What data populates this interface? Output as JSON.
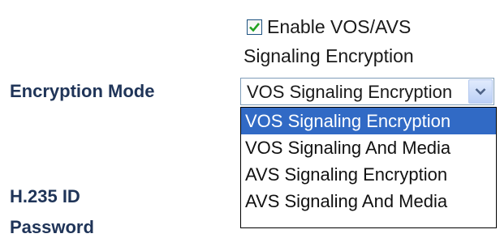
{
  "enable": {
    "checked": true,
    "label_line1": "Enable VOS/AVS",
    "label_line2": "Signaling Encryption"
  },
  "fields": {
    "encryption_mode_label": "Encryption Mode",
    "h235_label": "H.235 ID",
    "partial_label": "Password"
  },
  "encryption_mode": {
    "selected_value": "VOS Signaling Encryption",
    "options": [
      "VOS Signaling Encryption",
      "VOS Signaling And Media",
      "AVS Signaling Encryption",
      "AVS Signaling And Media"
    ],
    "highlighted_index": 0
  },
  "colors": {
    "label_color": "#1f3458",
    "highlight": "#316ac5",
    "checkmark": "#21a121"
  }
}
